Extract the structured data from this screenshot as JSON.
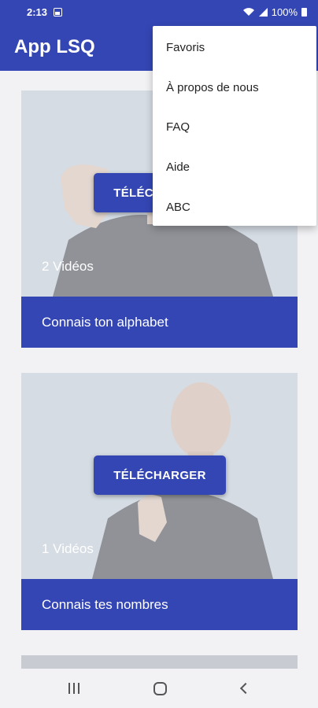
{
  "status_bar": {
    "time": "2:13",
    "battery": "100%"
  },
  "app_bar": {
    "title": "App LSQ"
  },
  "cards": [
    {
      "count": "2 Vidéos",
      "caption": "Connais ton alphabet",
      "button": "TÉLÉCHARGER"
    },
    {
      "count": "1 Vidéos",
      "caption": "Connais tes nombres",
      "button": "TÉLÉCHARGER"
    }
  ],
  "menu": {
    "items": [
      "Favoris",
      "À propos de nous",
      "FAQ",
      "Aide",
      "ABC"
    ]
  },
  "colors": {
    "primary": "#3446b4",
    "background": "#f2f2f5"
  }
}
